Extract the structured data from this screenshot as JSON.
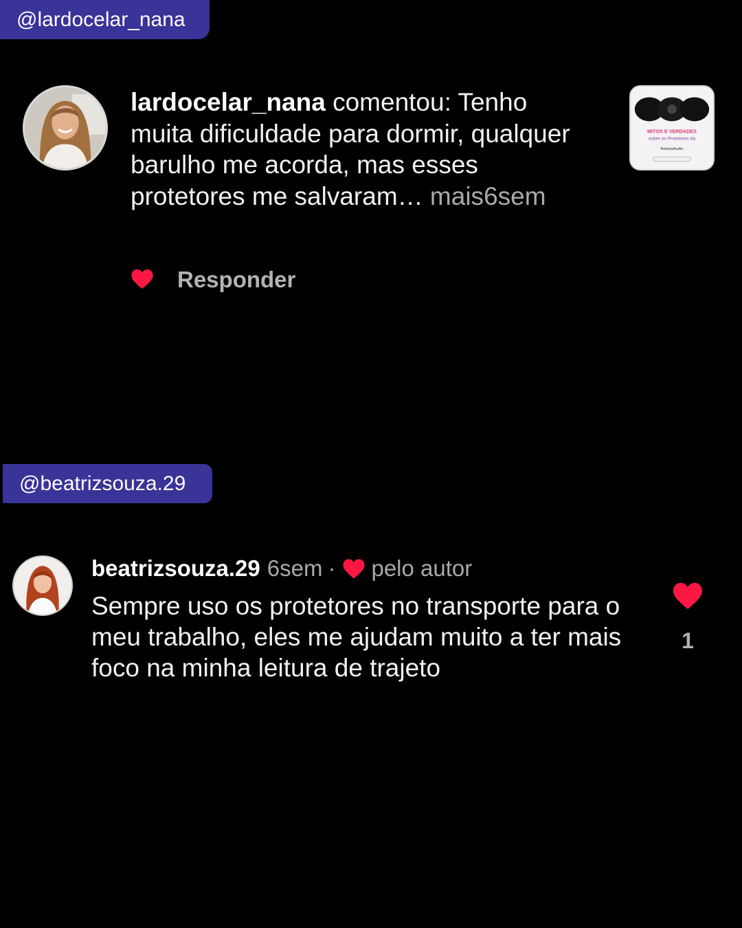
{
  "tags": {
    "first": "@lardocelar_nana",
    "second": "@beatrizsouza.29"
  },
  "comment1": {
    "username": "lardocelar_nana",
    "action": " comentou: ",
    "line1": "Tenho",
    "text": "muita dificuldade para dormir, qualquer barulho me acorda, mas esses protetores me salvaram…",
    "more": " mais",
    "time": "6sem",
    "reply_label": "Responder",
    "avatar_icon": "profile-photo",
    "like_icon": "heart-filled-icon",
    "post_thumbnail": {
      "title_line1": "MITOS E VERDADES",
      "title_line2": "sobre os Protetores da",
      "brand": "NebulaAudio"
    }
  },
  "comment2": {
    "username": "beatrizsouza.29",
    "time": "6sem",
    "separator": "·",
    "liked_by_author": "pelo autor",
    "text": "Sempre uso os protetores no transporte para o meu trabalho, eles me ajudam muito a ter mais foco na minha leitura de trajeto",
    "like_count": "1",
    "like_icon": "heart-filled-icon"
  },
  "colors": {
    "background": "#000000",
    "tag_bg": "#3a3398",
    "heart": "#ff1744",
    "muted": "#a9a9a9"
  }
}
